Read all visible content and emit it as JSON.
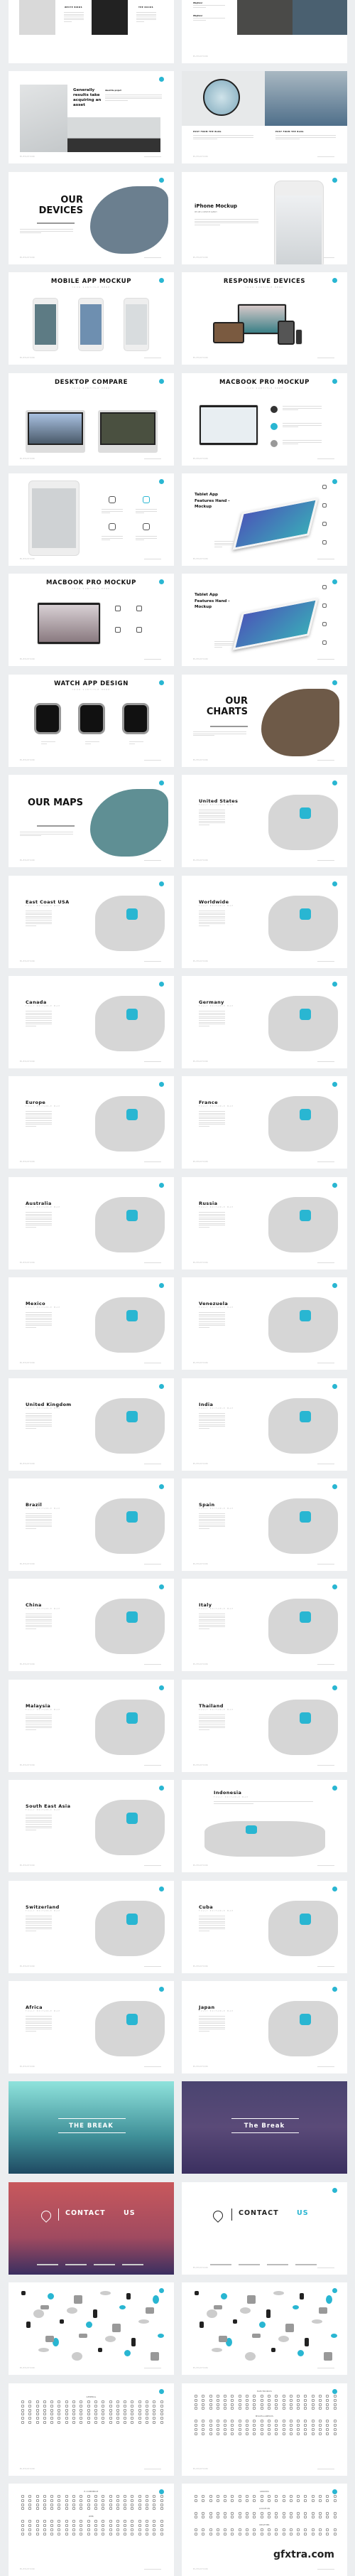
{
  "accent": "#29b6d2",
  "footer_brand": "ELEVATION",
  "slides": [
    {
      "type": "grid",
      "tiles": [
        "WHITE BIRDS",
        "THE ROCKS"
      ]
    },
    {
      "type": "bloggrid",
      "items": [
        "Wayfarer",
        "Wayfarer",
        "Wayfarer",
        "Wayfarer"
      ],
      "photos": [
        "BLOG POST THREE",
        "BLOG FOURTH"
      ]
    },
    {
      "type": "article",
      "title": "Generally results take acquiring an asset",
      "label": "About the project"
    },
    {
      "type": "posts",
      "posts": [
        "POST FROM THE BLOG",
        "POST FROM THE BLOG"
      ]
    },
    {
      "type": "section",
      "title": "OUR DEVICES",
      "img": "#6b7f8f"
    },
    {
      "type": "mockup",
      "title": "iPhone Mockup",
      "sub": "WE ARE A CREATIVE AGENCY"
    },
    {
      "type": "centered",
      "title": "MOBILE APP MOCKUP",
      "sub": "YOUR SUBTITLE HERE",
      "dev": "phones"
    },
    {
      "type": "centered",
      "title": "RESPONSIVE DEVICES",
      "sub": "YOUR SUBTITLE HERE",
      "dev": "responsive"
    },
    {
      "type": "centered",
      "title": "DESKTOP COMPARE",
      "sub": "YOUR SUBTITLE HERE",
      "dev": "desktops"
    },
    {
      "type": "centered",
      "title": "MACBOOK PRO MOCKUP",
      "sub": "YOUR SUBTITLE HERE",
      "dev": "laptop"
    },
    {
      "type": "ipad"
    },
    {
      "type": "tablet",
      "title": "Tablet App Features Hand - Mockup"
    },
    {
      "type": "centered",
      "title": "MACBOOK PRO MOCKUP",
      "sub": "YOUR SUBTITLE HERE",
      "dev": "laptop2"
    },
    {
      "type": "tablet",
      "title": "Tablet App Features Hand - Mockup"
    },
    {
      "type": "centered",
      "title": "WATCH APP DESIGN",
      "sub": "YOUR SUBTITLE HERE",
      "dev": "watches"
    },
    {
      "type": "section",
      "title": "OUR CHARTS",
      "img": "#6e5a48",
      "right": true
    },
    {
      "type": "section",
      "title": "OUR MAPS",
      "img": "#5f8f94"
    },
    {
      "type": "map",
      "title": "United States"
    },
    {
      "type": "map",
      "title": "East Coast USA"
    },
    {
      "type": "map",
      "title": "Worldwide"
    },
    {
      "type": "map",
      "title": "Canada"
    },
    {
      "type": "map",
      "title": "Germany"
    },
    {
      "type": "map",
      "title": "Europe"
    },
    {
      "type": "map",
      "title": "France"
    },
    {
      "type": "map",
      "title": "Australia"
    },
    {
      "type": "map",
      "title": "Russia"
    },
    {
      "type": "map",
      "title": "Mexico"
    },
    {
      "type": "map",
      "title": "Venezuela"
    },
    {
      "type": "map",
      "title": "United Kingdom"
    },
    {
      "type": "map",
      "title": "India"
    },
    {
      "type": "map",
      "title": "Brazil"
    },
    {
      "type": "map",
      "title": "Spain"
    },
    {
      "type": "map",
      "title": "China"
    },
    {
      "type": "map",
      "title": "Italy"
    },
    {
      "type": "map",
      "title": "Malaysia"
    },
    {
      "type": "map",
      "title": "Thailand"
    },
    {
      "type": "map",
      "title": "South East Asia"
    },
    {
      "type": "map",
      "title": "Indonesia"
    },
    {
      "type": "map",
      "title": "Switzerland"
    },
    {
      "type": "map",
      "title": "Cuba"
    },
    {
      "type": "map",
      "title": "Africa"
    },
    {
      "type": "map",
      "title": "Japan"
    },
    {
      "type": "break",
      "title": "THE BREAK",
      "bg": "linear-gradient(180deg,#8fe3dc,#3f8f98 60%,#1f4a62)"
    },
    {
      "type": "break",
      "title": "The Break",
      "bg": "linear-gradient(180deg,#4a4470,#5a4a78 50%,#3b3060)"
    },
    {
      "type": "contact",
      "title1": "CONTACT",
      "title2": "US",
      "dark": true
    },
    {
      "type": "contact",
      "title1": "CONTACT",
      "title2": "US",
      "dark": false
    },
    {
      "type": "infographic"
    },
    {
      "type": "infographic"
    },
    {
      "type": "icons",
      "sections": [
        "GENERAL"
      ]
    },
    {
      "type": "icons",
      "sections": [
        "ELECTRONICS",
        "MISCELLANEOUS"
      ]
    },
    {
      "type": "icons",
      "sections": [
        "E-COMMERCE",
        "WEB"
      ]
    },
    {
      "type": "icons",
      "sections": [
        "ARROWS",
        "LOCATION",
        "WEATHER"
      ]
    }
  ],
  "watermark": "gfxtra.com"
}
